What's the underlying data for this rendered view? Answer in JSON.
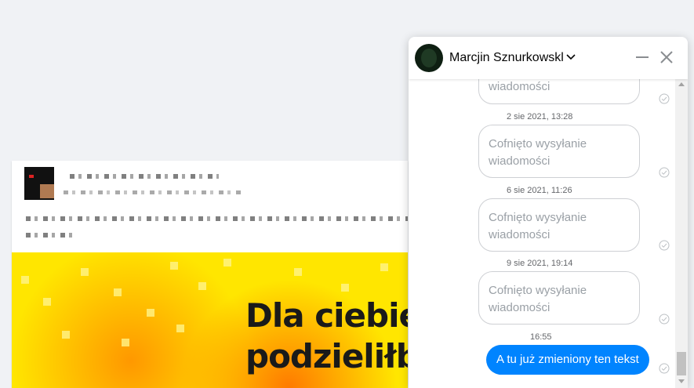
{
  "feed_post": {
    "image_headline": [
      "Dla ciebie",
      "podzieliłby"
    ]
  },
  "chat": {
    "contact_name": "Marcjin Sznurkowskl",
    "icons": {
      "name_dropdown": "chevron-down-icon",
      "minimize": "minimize-icon",
      "close": "close-icon",
      "read_receipt": "check-circle-icon"
    },
    "partial_top_message": "wiadomości",
    "entries": [
      {
        "timestamp": "2 sie 2021, 13:28",
        "text": "Cofnięto wysyłanie wiadomości"
      },
      {
        "timestamp": "6 sie 2021, 11:26",
        "text": "Cofnięto wysyłanie wiadomości"
      },
      {
        "timestamp": "9 sie 2021, 19:14",
        "text": "Cofnięto wysyłanie wiadomości"
      }
    ],
    "last_timestamp": "16:55",
    "last_message": "A tu już zmieniony ten tekst",
    "colors": {
      "sent_bubble": "#0084ff",
      "unsent_border": "#ced0d4"
    }
  }
}
